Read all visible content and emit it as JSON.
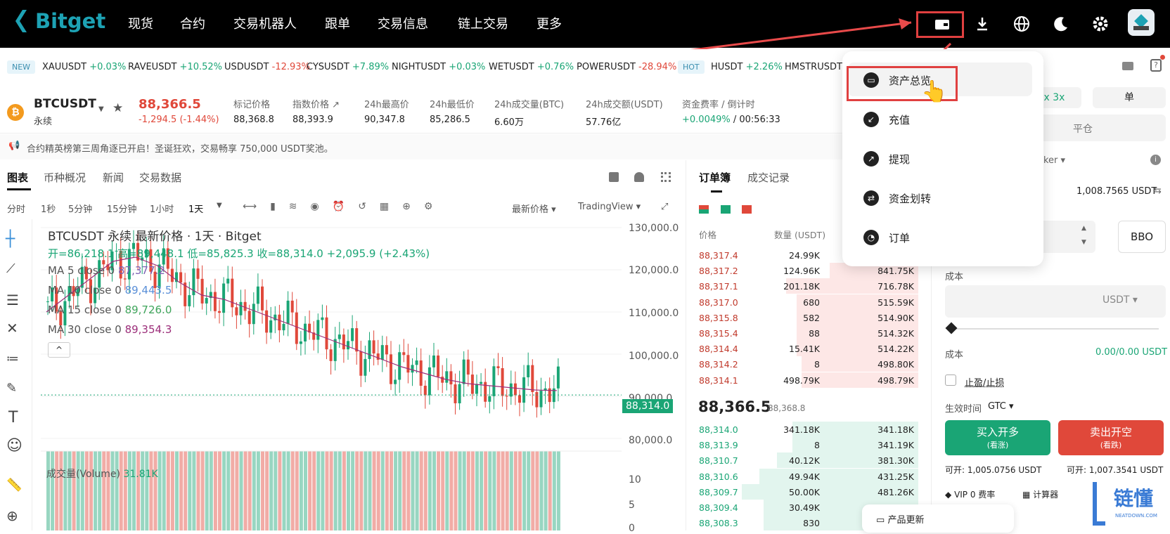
{
  "nav": {
    "logo": "Bitget",
    "items": [
      "现货",
      "合约",
      "交易机器人",
      "跟单",
      "交易信息",
      "链上交易",
      "更多"
    ]
  },
  "ticker": {
    "new_badge": "NEW",
    "hot_badge": "HOT",
    "items": [
      {
        "sym": "XAUUSDT",
        "chg": "+0.03%",
        "dir": "up"
      },
      {
        "sym": "RAVEUSDT",
        "chg": "+10.52%",
        "dir": "up"
      },
      {
        "sym": "USDUSDT",
        "chg": "-12.93%",
        "dir": "dn"
      },
      {
        "sym": "CYSUSDT",
        "chg": "+7.89%",
        "dir": "up"
      },
      {
        "sym": "NIGHTUSDT",
        "chg": "+0.03%",
        "dir": "up"
      },
      {
        "sym": "WETUSDT",
        "chg": "+0.76%",
        "dir": "up"
      },
      {
        "sym": "POWERUSDT",
        "chg": "-28.94%",
        "dir": "dn"
      }
    ],
    "hot_items": [
      {
        "sym": "HUSDT",
        "chg": "+2.26%",
        "dir": "up"
      },
      {
        "sym": "HMSTRUSDT",
        "chg": "",
        "dir": "up"
      }
    ]
  },
  "pair": {
    "symbol": "BTCUSDT",
    "type": "永续",
    "price": "88,366.5",
    "change": "-1,294.5 (-1.44%)"
  },
  "stats": [
    {
      "label": "标记价格",
      "value": "88,368.8"
    },
    {
      "label": "指数价格",
      "value": "88,393.9"
    },
    {
      "label": "24h最高价",
      "value": "90,347.8"
    },
    {
      "label": "24h最低价",
      "value": "85,286.5"
    },
    {
      "label": "24h成交量(BTC)",
      "value": "6.60万"
    },
    {
      "label": "24h成交额(USDT)",
      "value": "57.76亿"
    },
    {
      "label": "资金费率 / 倒计时",
      "value": "+0.0049%",
      "value2": "/ 00:56:33"
    }
  ],
  "notice": "合约精英榜第三周角逐已开启！圣诞狂欢，交易畅享 750,000 USDT奖池。",
  "chart_tabs": [
    "图表",
    "币种概况",
    "新闻",
    "交易数据"
  ],
  "timeframes": [
    "分时",
    "1秒",
    "5分钟",
    "15分钟",
    "1小时",
    "1天"
  ],
  "chart_opts": {
    "price_type": "最新价格",
    "view": "TradingView"
  },
  "chart_legend": {
    "title": "BTCUSDT 永续 最新价格 · 1天 · Bitget",
    "ohlc_o": "开=86,218.1",
    "ohlc_h": "高=89,448.1",
    "ohlc_l": "低=85,825.3",
    "ohlc_c": "收=88,314.0",
    "ohlc_chg": "+2,095.9 (+2.43%)",
    "ma": [
      {
        "label": "MA 5 close 0",
        "value": "87,377.2",
        "color": "#7b5fb3"
      },
      {
        "label": "MA 10 close 0",
        "value": "89,443.5",
        "color": "#5a8fd8"
      },
      {
        "label": "MA 15 close 0",
        "value": "89,726.0",
        "color": "#3fa55b"
      },
      {
        "label": "MA 30 close 0",
        "value": "89,354.3",
        "color": "#9c2e7a"
      }
    ]
  },
  "volume": {
    "label": "成交量(Volume)",
    "value": "31.81K"
  },
  "chart_data": {
    "type": "line",
    "title": "BTCUSDT 永续 最新价格 · 1天 · Bitget",
    "ylim": [
      75000,
      130000
    ],
    "yticks": [
      "130,000.0",
      "120,000.0",
      "110,000.0",
      "100,000.0",
      "90,000.0",
      "80,000.0"
    ],
    "last_price": "88,314.0",
    "series": [
      {
        "name": "MA 30 close 0",
        "values": [
          108000,
          112000,
          116000,
          120000,
          121000,
          119000,
          115000,
          112000,
          111000,
          109000,
          107000,
          105000,
          103000,
          101000,
          99000,
          97000,
          95000,
          93500,
          92000,
          91000,
          90500,
          90000,
          89500,
          89354
        ]
      }
    ]
  },
  "vol_axis": [
    "10",
    "5",
    "0"
  ],
  "orderbook": {
    "tabs": [
      "订单簿",
      "成交记录"
    ],
    "headers": [
      "价格",
      "数量 (USDT)"
    ],
    "asks": [
      {
        "p": "88,317.4",
        "q": "24.99K",
        "t": "",
        "f": 0.08
      },
      {
        "p": "88,317.2",
        "q": "124.96K",
        "t": "841.75K",
        "f": 0.4
      },
      {
        "p": "88,317.1",
        "q": "201.18K",
        "t": "716.78K",
        "f": 0.6
      },
      {
        "p": "88,317.0",
        "q": "680",
        "t": "515.59K",
        "f": 0.55
      },
      {
        "p": "88,315.8",
        "q": "582",
        "t": "514.90K",
        "f": 0.55
      },
      {
        "p": "88,315.4",
        "q": "88",
        "t": "514.32K",
        "f": 0.55
      },
      {
        "p": "88,314.4",
        "q": "15.41K",
        "t": "514.22K",
        "f": 0.55
      },
      {
        "p": "88,314.2",
        "q": "8",
        "t": "498.80K",
        "f": 0.53
      },
      {
        "p": "88,314.1",
        "q": "498.79K",
        "t": "498.79K",
        "f": 0.53
      }
    ],
    "mid": "88,366.5",
    "mid_ref": "88,368.8",
    "bids": [
      {
        "p": "88,314.0",
        "q": "341.18K",
        "t": "341.18K",
        "f": 0.57
      },
      {
        "p": "88,313.9",
        "q": "8",
        "t": "341.19K",
        "f": 0.57
      },
      {
        "p": "88,310.7",
        "q": "40.12K",
        "t": "381.30K",
        "f": 0.64
      },
      {
        "p": "88,310.6",
        "q": "49.94K",
        "t": "431.25K",
        "f": 0.72
      },
      {
        "p": "88,309.7",
        "q": "50.00K",
        "t": "481.26K",
        "f": 0.8
      },
      {
        "p": "88,309.4",
        "q": "30.49K",
        "t": "",
        "f": 0.7
      },
      {
        "p": "88,308.3",
        "q": "830",
        "t": "",
        "f": 0.7
      }
    ]
  },
  "trade": {
    "mode": "单",
    "leverage": "2x 3x",
    "close": "平仓",
    "maker": "aker",
    "avail_amount": "1,008.7565 USDT",
    "bbo": "BBO",
    "cost_label": "成本",
    "unit": "USDT",
    "cost_value": "0.00/0.00 USDT",
    "tpsl": "止盈/止损",
    "tif_label": "生效时间",
    "tif": "GTC",
    "buy": "买入开多",
    "buy_sub": "(看涨)",
    "sell": "卖出开空",
    "sell_sub": "(看跌)",
    "buy_avail": "可开: 1,005.0756 USDT",
    "sell_avail": "可开: 1,007.3541 USDT",
    "vip": "VIP 0 费率",
    "calc": "计算器",
    "product_update": "产品更新"
  },
  "dropdown": {
    "items": [
      {
        "label": "资产总览",
        "icon": "wallet-icon"
      },
      {
        "label": "充值",
        "icon": "deposit-icon"
      },
      {
        "label": "提现",
        "icon": "withdraw-icon"
      },
      {
        "label": "资金划转",
        "icon": "transfer-icon"
      },
      {
        "label": "订单",
        "icon": "order-icon"
      }
    ]
  },
  "watermark": {
    "text": "链懂",
    "sub": "NEATDOWN.COM"
  },
  "colors": {
    "up": "#1aa575",
    "down": "#e0483a",
    "accent": "#1da2b4"
  }
}
